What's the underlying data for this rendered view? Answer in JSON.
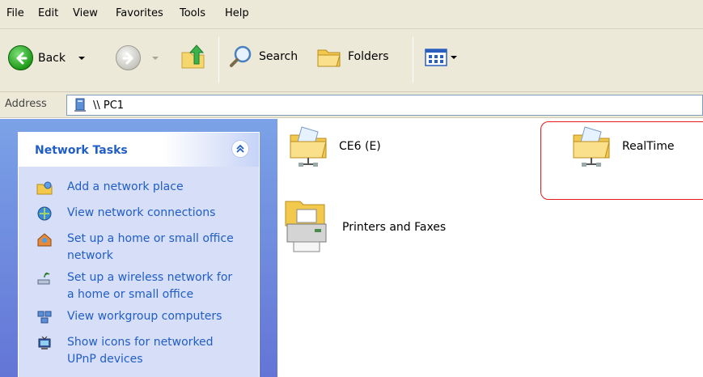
{
  "menu": [
    "File",
    "Edit",
    "View",
    "Favorites",
    "Tools",
    "Help"
  ],
  "toolbar": {
    "back_label": "Back",
    "search_label": "Search",
    "folders_label": "Folders"
  },
  "address": {
    "label": "Address",
    "value": "\\\\ PC1"
  },
  "tasks": {
    "title": "Network Tasks",
    "items": [
      "Add a network place",
      "View network connections",
      "Set up a home or small office network",
      "Set up a wireless network for a home or small office",
      "View workgroup computers",
      "Show icons for networked UPnP devices"
    ]
  },
  "content": {
    "items": [
      "CE6 (E)",
      "RealTime",
      "Printers and Faxes"
    ]
  },
  "colors": {
    "highlight": "#e8191b",
    "task_link": "#215dc6"
  }
}
